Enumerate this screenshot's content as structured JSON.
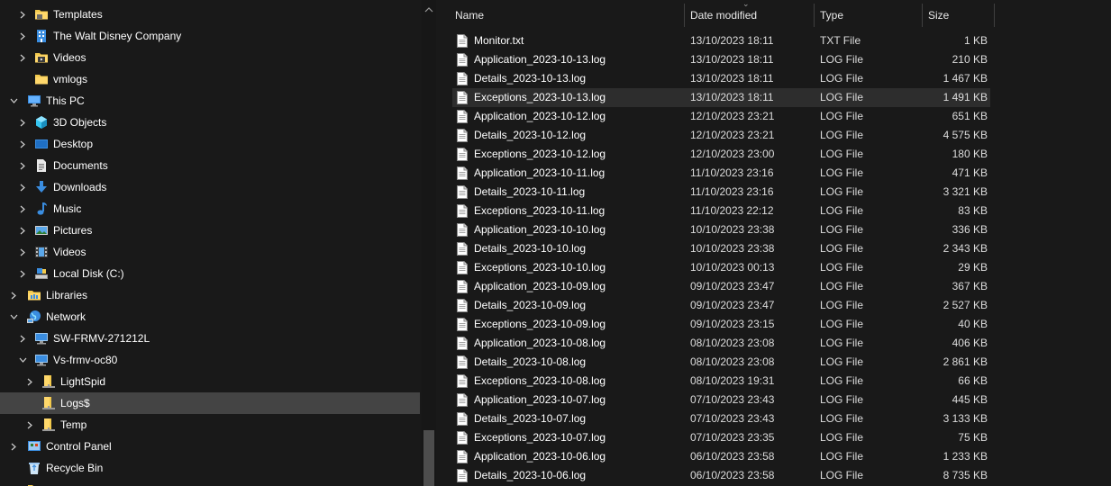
{
  "nav": {
    "items": [
      {
        "label": "Templates",
        "level": 1,
        "expandable": true,
        "icon": "templates-folder-icon",
        "selected": false
      },
      {
        "label": "The Walt Disney Company",
        "level": 1,
        "expandable": true,
        "icon": "company-building-icon",
        "selected": false
      },
      {
        "label": "Videos",
        "level": 1,
        "expandable": true,
        "icon": "videos-folder-icon",
        "selected": false
      },
      {
        "label": "vmlogs",
        "level": 1,
        "expandable": false,
        "icon": "folder-icon",
        "selected": false
      },
      {
        "label": "This PC",
        "level": 0,
        "expandable": true,
        "expanded": true,
        "icon": "this-pc-icon",
        "selected": false
      },
      {
        "label": "3D Objects",
        "level": 1,
        "expandable": true,
        "icon": "3d-objects-icon",
        "selected": false
      },
      {
        "label": "Desktop",
        "level": 1,
        "expandable": true,
        "icon": "desktop-icon",
        "selected": false
      },
      {
        "label": "Documents",
        "level": 1,
        "expandable": true,
        "icon": "documents-icon",
        "selected": false
      },
      {
        "label": "Downloads",
        "level": 1,
        "expandable": true,
        "icon": "downloads-icon",
        "selected": false
      },
      {
        "label": "Music",
        "level": 1,
        "expandable": true,
        "icon": "music-icon",
        "selected": false
      },
      {
        "label": "Pictures",
        "level": 1,
        "expandable": true,
        "icon": "pictures-icon",
        "selected": false
      },
      {
        "label": "Videos",
        "level": 1,
        "expandable": true,
        "icon": "videos-icon",
        "selected": false
      },
      {
        "label": "Local Disk (C:)",
        "level": 1,
        "expandable": true,
        "icon": "local-disk-icon",
        "selected": false
      },
      {
        "label": "Libraries",
        "level": 0,
        "expandable": true,
        "icon": "libraries-icon",
        "selected": false
      },
      {
        "label": "Network",
        "level": 0,
        "expandable": true,
        "expanded": true,
        "icon": "network-icon",
        "selected": false
      },
      {
        "label": "SW-FRMV-271212L",
        "level": 1,
        "expandable": true,
        "icon": "computer-icon",
        "selected": false
      },
      {
        "label": "Vs-frmv-oc80",
        "level": 1,
        "expandable": true,
        "expanded": true,
        "icon": "computer-icon",
        "selected": false
      },
      {
        "label": "LightSpid",
        "level": 2,
        "expandable": true,
        "icon": "share-folder-icon",
        "selected": false
      },
      {
        "label": "Logs$",
        "level": 2,
        "expandable": false,
        "icon": "share-folder-icon",
        "selected": true
      },
      {
        "label": "Temp",
        "level": 2,
        "expandable": true,
        "icon": "share-folder-icon",
        "selected": false
      },
      {
        "label": "Control Panel",
        "level": 0,
        "expandable": true,
        "icon": "control-panel-icon",
        "selected": false
      },
      {
        "label": "Recycle Bin",
        "level": 0,
        "expandable": false,
        "icon": "recycle-bin-icon",
        "selected": false
      },
      {
        "label": "",
        "level": 0,
        "expandable": true,
        "icon": "folder-icon",
        "selected": false
      }
    ]
  },
  "columns": {
    "name": "Name",
    "date": "Date modified",
    "type": "Type",
    "size": "Size"
  },
  "files": [
    {
      "name": "Monitor.txt",
      "date": "13/10/2023 18:11",
      "type": "TXT File",
      "size": "1 KB"
    },
    {
      "name": "Application_2023-10-13.log",
      "date": "13/10/2023 18:11",
      "type": "LOG File",
      "size": "210 KB"
    },
    {
      "name": "Details_2023-10-13.log",
      "date": "13/10/2023 18:11",
      "type": "LOG File",
      "size": "1 467 KB"
    },
    {
      "name": "Exceptions_2023-10-13.log",
      "date": "13/10/2023 18:11",
      "type": "LOG File",
      "size": "1 491 KB",
      "hover": true
    },
    {
      "name": "Application_2023-10-12.log",
      "date": "12/10/2023 23:21",
      "type": "LOG File",
      "size": "651 KB"
    },
    {
      "name": "Details_2023-10-12.log",
      "date": "12/10/2023 23:21",
      "type": "LOG File",
      "size": "4 575 KB"
    },
    {
      "name": "Exceptions_2023-10-12.log",
      "date": "12/10/2023 23:00",
      "type": "LOG File",
      "size": "180 KB"
    },
    {
      "name": "Application_2023-10-11.log",
      "date": "11/10/2023 23:16",
      "type": "LOG File",
      "size": "471 KB"
    },
    {
      "name": "Details_2023-10-11.log",
      "date": "11/10/2023 23:16",
      "type": "LOG File",
      "size": "3 321 KB"
    },
    {
      "name": "Exceptions_2023-10-11.log",
      "date": "11/10/2023 22:12",
      "type": "LOG File",
      "size": "83 KB"
    },
    {
      "name": "Application_2023-10-10.log",
      "date": "10/10/2023 23:38",
      "type": "LOG File",
      "size": "336 KB"
    },
    {
      "name": "Details_2023-10-10.log",
      "date": "10/10/2023 23:38",
      "type": "LOG File",
      "size": "2 343 KB"
    },
    {
      "name": "Exceptions_2023-10-10.log",
      "date": "10/10/2023 00:13",
      "type": "LOG File",
      "size": "29 KB"
    },
    {
      "name": "Application_2023-10-09.log",
      "date": "09/10/2023 23:47",
      "type": "LOG File",
      "size": "367 KB"
    },
    {
      "name": "Details_2023-10-09.log",
      "date": "09/10/2023 23:47",
      "type": "LOG File",
      "size": "2 527 KB"
    },
    {
      "name": "Exceptions_2023-10-09.log",
      "date": "09/10/2023 23:15",
      "type": "LOG File",
      "size": "40 KB"
    },
    {
      "name": "Application_2023-10-08.log",
      "date": "08/10/2023 23:08",
      "type": "LOG File",
      "size": "406 KB"
    },
    {
      "name": "Details_2023-10-08.log",
      "date": "08/10/2023 23:08",
      "type": "LOG File",
      "size": "2 861 KB"
    },
    {
      "name": "Exceptions_2023-10-08.log",
      "date": "08/10/2023 19:31",
      "type": "LOG File",
      "size": "66 KB"
    },
    {
      "name": "Application_2023-10-07.log",
      "date": "07/10/2023 23:43",
      "type": "LOG File",
      "size": "445 KB"
    },
    {
      "name": "Details_2023-10-07.log",
      "date": "07/10/2023 23:43",
      "type": "LOG File",
      "size": "3 133 KB"
    },
    {
      "name": "Exceptions_2023-10-07.log",
      "date": "07/10/2023 23:35",
      "type": "LOG File",
      "size": "75 KB"
    },
    {
      "name": "Application_2023-10-06.log",
      "date": "06/10/2023 23:58",
      "type": "LOG File",
      "size": "1 233 KB"
    },
    {
      "name": "Details_2023-10-06.log",
      "date": "06/10/2023 23:58",
      "type": "LOG File",
      "size": "8 735 KB"
    }
  ],
  "colors": {
    "background": "#191919",
    "selected": "#444444",
    "hover": "#2d2d2d",
    "folder_yellow": "#f2c94c",
    "accent_blue": "#3a8de0"
  }
}
